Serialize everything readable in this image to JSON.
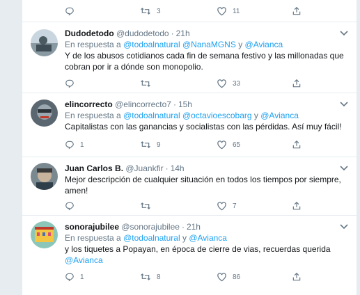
{
  "top_actions": {
    "retweets": "3",
    "likes": "11"
  },
  "tweets": [
    {
      "name": "Dudodetodo",
      "handle": "@dudodetodo",
      "sep": "·",
      "time": "21h",
      "reply_prefix": "En respuesta a",
      "mentions": [
        "@todoalnatural",
        "@NanaMGNS",
        "@Avianca"
      ],
      "joiner": "y",
      "text": "Y de los abusos cotidianos cada fin de semana festivo y las millonadas que cobran por ir a dónde son monopolio.",
      "replies": "",
      "retweets": "",
      "likes": "33"
    },
    {
      "name": "elincorrecto",
      "handle": "@elincorrecto7",
      "sep": "·",
      "time": "15h",
      "reply_prefix": "En respuesta a",
      "mentions": [
        "@todoalnatural",
        "@octavioescobarg",
        "@Avianca"
      ],
      "joiner": "y",
      "text": "Capitalistas con las ganancias y socialistas con las pérdidas. Así muy fácil!",
      "replies": "1",
      "retweets": "9",
      "likes": "65"
    },
    {
      "name": "Juan Carlos B.",
      "handle": "@Juankfir",
      "sep": "·",
      "time": "14h",
      "text": "Mejor descripción de cualquier situación en todos los tiempos por siempre, amen!",
      "replies": "",
      "retweets": "",
      "likes": "7"
    },
    {
      "name": "sonorajubilee",
      "handle": "@sonorajubilee",
      "sep": "·",
      "time": "21h",
      "reply_prefix": "En respuesta a",
      "mentions": [
        "@todoalnatural",
        "@Avianca"
      ],
      "joiner": "y",
      "text": "y los tiquetes a Popayan, en época de cierre de vias, recuerdas querida",
      "text_mention": "@Avianca",
      "replies": "1",
      "retweets": "8",
      "likes": "86"
    }
  ],
  "colors": {
    "accent": "#1da1f2",
    "muted": "#657786",
    "divider": "#e6ecf0"
  },
  "icons": [
    "reply-icon",
    "retweet-icon",
    "like-icon",
    "share-icon",
    "chevron-down-icon"
  ]
}
